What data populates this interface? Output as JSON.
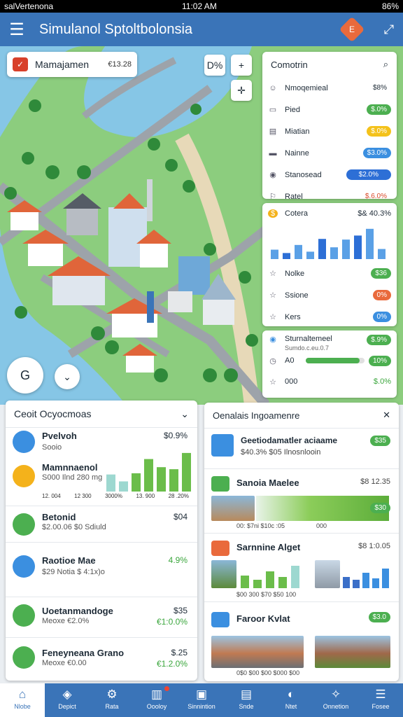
{
  "status": {
    "carrier": "salVertenona",
    "time": "11:02 AM",
    "battery": "86%"
  },
  "appbar": {
    "title": "Simulanol Sptoltbolonsia",
    "badge": "E"
  },
  "map_overlay": {
    "mgmt_label": "Mamajamen",
    "mgmt_value": "€13.28",
    "pct_btn": "D%",
    "plus": "+",
    "locate": "✛",
    "g_label": "G",
    "chev": "⌄"
  },
  "comparison": {
    "title": "Comotrin",
    "rows": [
      {
        "icon": "☺",
        "name": "Nmoqemieal",
        "value": "$8%",
        "color": ""
      },
      {
        "icon": "▭",
        "name": "Pied",
        "value": "$.0%",
        "color": "#4caf50"
      },
      {
        "icon": "▤",
        "name": "Miatian",
        "value": "$.0%",
        "color": "#f4c21b"
      },
      {
        "icon": "▬",
        "name": "Nainne",
        "value": "$3.0%",
        "color": "#3b8fe0"
      },
      {
        "icon": "◉",
        "name": "Stanosead",
        "value": "$2.0%",
        "color": "#2d6fd6"
      },
      {
        "icon": "⚐",
        "name": "Ratel",
        "value": "$.6.0%",
        "color": ""
      }
    ]
  },
  "costs": {
    "title": "Cotera",
    "header_value": "$& 40.3%",
    "bars": [
      0.28,
      0.18,
      0.42,
      0.22,
      0.6,
      0.35,
      0.58,
      0.7,
      0.9,
      0.3
    ],
    "rows": [
      {
        "icon": "☆",
        "name": "Nolke",
        "value": "$36",
        "color": "#4caf50"
      },
      {
        "icon": "☆",
        "name": "Ssione",
        "value": "0%",
        "color": "#e96a3c"
      },
      {
        "icon": "☆",
        "name": "Kers",
        "value": "0%",
        "color": "#3b8fe0"
      }
    ]
  },
  "stats": {
    "title": "Sturnaltemeel",
    "sub": "Sumdo.c.eu.0.7",
    "value": "$.9%",
    "row2_label": "A0",
    "row2_value": "10%",
    "progress": 0.92,
    "row3_label": "000",
    "row3_value": "$.0%"
  },
  "left": {
    "title": "Ceoit Ocyocmoas",
    "items": [
      {
        "name": "Pvelvoh",
        "sub": "Sooio",
        "value": "$0.9%"
      },
      {
        "name": "Mamnnaenol",
        "sub": "S000 Ilnd 280 mg",
        "value": ""
      },
      {
        "name": "Betonid",
        "sub": "$2.00.06  $0  Sdiuld",
        "value": "$04"
      },
      {
        "name": "Raotioe Mae",
        "sub": "$29 Notia $ 4:1x)o",
        "value": "4.9%"
      },
      {
        "name": "Uoetanmandoge",
        "sub": "Meoxe  €2.0%",
        "value": "$35",
        "value2": "€1:0.0%"
      },
      {
        "name": "Feneyneana Grano",
        "sub": "Meoxe  €0.00",
        "value": "$.25",
        "value2": "€1.2.0%"
      }
    ],
    "chart_ticks": [
      "12. 004",
      "12 300",
      "3000%",
      "13. 900",
      "28 .20%"
    ],
    "chart_bars": [
      0.42,
      0.25,
      0.45,
      0.8,
      0.6,
      0.55,
      0.95
    ]
  },
  "management": {
    "title": "Oenalais Ingoamenre",
    "items": [
      {
        "name": "Geetiodamatler aciaame",
        "sub": "$40.3%  $05 Ilnosnlooin",
        "badge": "$35"
      },
      {
        "name": "Sanoia Maelee",
        "value": "$8 12.35",
        "badge": "$30",
        "ticks": "00:  $7ni  $10c  :05",
        "extra": "000"
      },
      {
        "name": "Sarnnine Alget",
        "value": "$8 1:0.05",
        "ticks": "$00 300  $70  $50  100"
      },
      {
        "name": "Faroor Kvlat",
        "badge": "$3.0",
        "ticks": "0$0   $00  $00  $000 $00"
      }
    ]
  },
  "tabs": [
    "Nlobe",
    "Depict",
    "Rata",
    "Oooloy",
    "Sinnintion",
    "Snde",
    "Ntet",
    "Onnetion",
    "Fosee"
  ]
}
